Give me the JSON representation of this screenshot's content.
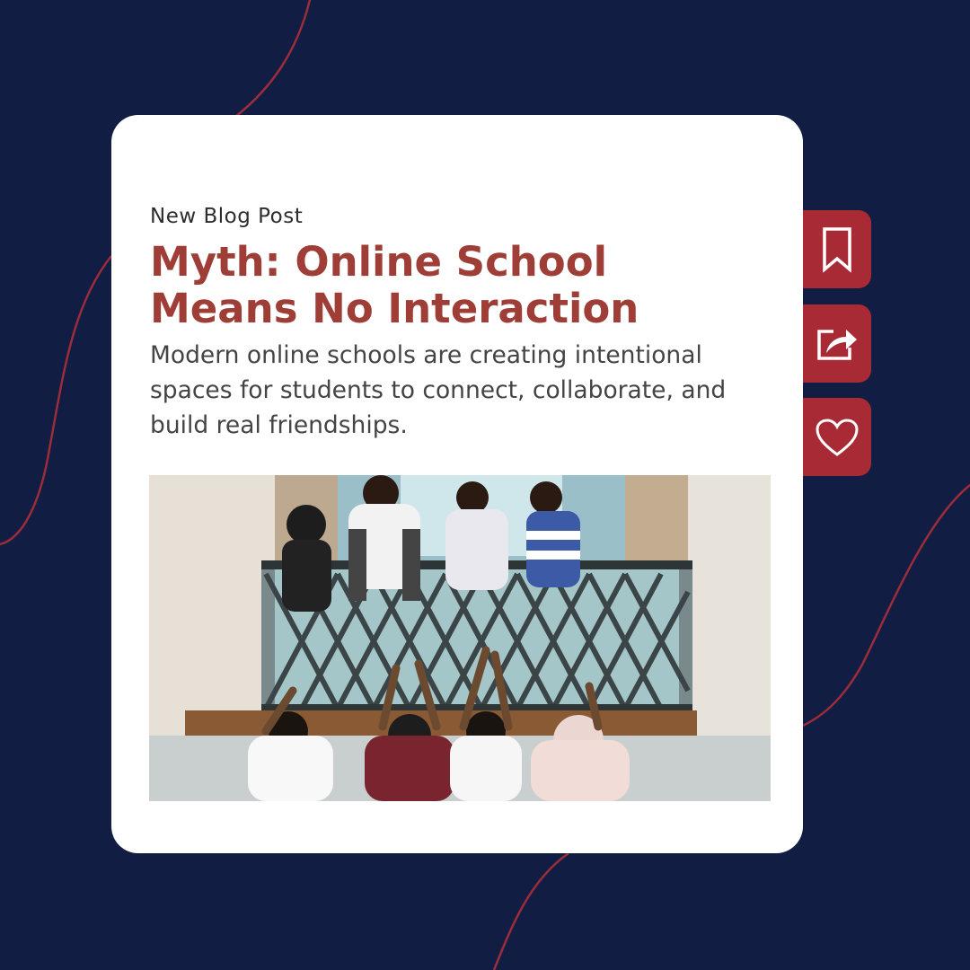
{
  "post": {
    "eyebrow": "New Blog Post",
    "title_line1": "Myth: Online School",
    "title_line2": "Means No Interaction",
    "description": "Modern online schools are creating intentional spaces for students to connect, collaborate, and build real friendships."
  },
  "actions": [
    {
      "label": "Save",
      "icon": "bookmark-icon"
    },
    {
      "label": "Share",
      "icon": "share-icon"
    },
    {
      "label": "Like",
      "icon": "heart-icon"
    }
  ],
  "colors": {
    "background": "#121d44",
    "card": "#ffffff",
    "accent": "#a82a35",
    "title": "#9e3e36",
    "curve": "#9b2d3a"
  }
}
